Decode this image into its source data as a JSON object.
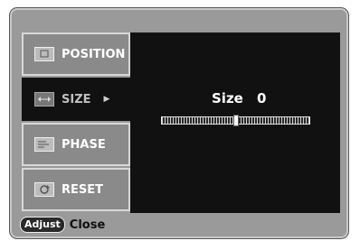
{
  "menu": {
    "items": [
      {
        "label": "POSITION",
        "icon": "position-icon"
      },
      {
        "label": "SIZE",
        "icon": "size-icon"
      },
      {
        "label": "PHASE",
        "icon": "phase-icon"
      },
      {
        "label": "RESET",
        "icon": "reset-icon"
      }
    ],
    "selected_arrow": "▶"
  },
  "adjustment": {
    "label": "Size",
    "value": "0",
    "level_fraction": 0.5
  },
  "footer": {
    "button_label": "Adjust",
    "action_label": "Close"
  },
  "colors": {
    "frame": "#9a9a9a",
    "panel": "#111111",
    "item": "#8a8a8a"
  }
}
